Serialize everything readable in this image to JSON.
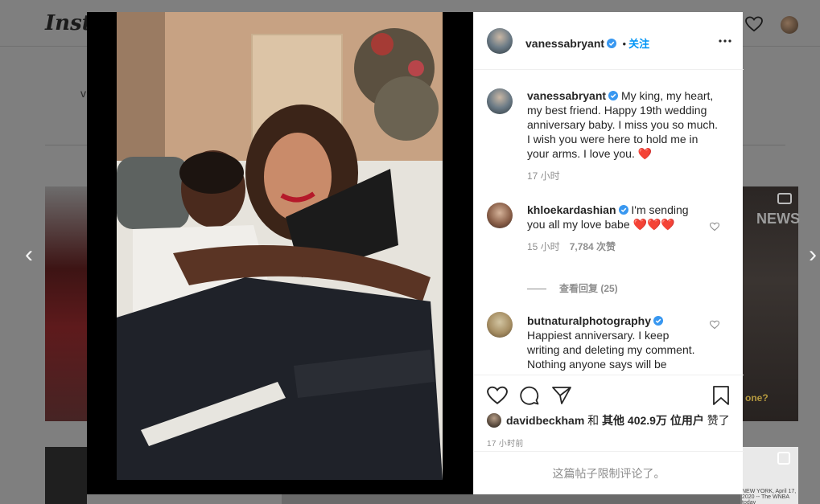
{
  "background": {
    "logo_text": "Insta",
    "partial_text": "v",
    "tile_right_badge": "NEWS",
    "tile_right_caption": "one?",
    "tile_br_caption": "NEW YORK, April 17, 2020 -- The WNBA today"
  },
  "nav": {
    "prev_glyph": "‹",
    "next_glyph": "›"
  },
  "post": {
    "author": "vanessabryant",
    "follow_separator": "•",
    "follow_label": "关注",
    "more_icon": "more-horizontal-icon",
    "caption": {
      "username": "vanessabryant",
      "text": "My king, my heart, my best friend. Happy 19th wedding anniversary baby. I miss you so much. I wish you were here to hold me in your arms. I love you.",
      "emoji": "❤️",
      "time": "17 小时"
    },
    "comments": [
      {
        "username": "khloekardashian",
        "text": "I'm sending you all my love babe",
        "emoji": "❤️❤️❤️",
        "time": "15 小时",
        "likes": "7,784 次赞",
        "view_replies": "查看回复 (25)"
      },
      {
        "username": "butnaturalphotography",
        "text": "Happiest anniversary. I keep writing and deleting my comment. Nothing anyone says will be enough... yet I really do"
      }
    ],
    "liked_by": {
      "user": "davidbeckham",
      "connector": "和",
      "others": "其他 402.9万 位用户",
      "suffix": "赞了"
    },
    "timestamp": "17 小时前",
    "comments_disabled": "这篇帖子限制评论了。"
  },
  "colors": {
    "accent": "#0095f6",
    "verified": "#3897f0",
    "heart": "#ed4956",
    "muted": "#8e8e8e"
  }
}
